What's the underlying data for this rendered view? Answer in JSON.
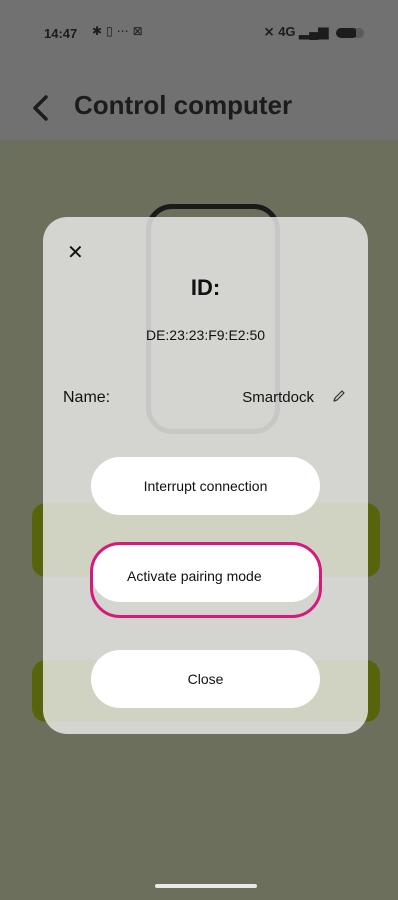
{
  "status_bar": {
    "time": "14:47",
    "left_icons": [
      "notification-bug-icon",
      "clipboard-icon",
      "aol-icon",
      "gallery-icon"
    ],
    "network": "4G",
    "signal": "signal-bars-icon",
    "battery": "battery-icon"
  },
  "header": {
    "title": "Control computer"
  },
  "modal": {
    "title": "ID:",
    "device_id": "DE:23:23:F9:E2:50",
    "name_label": "Name:",
    "name_value": "Smartdock",
    "interrupt_label": "Interrupt connection",
    "pairing_label": "Activate pairing mode",
    "close_label": "Close"
  },
  "colors": {
    "highlight": "#d6197a",
    "card_green": "#58640c",
    "modal_bg": "#e8e8e6"
  }
}
